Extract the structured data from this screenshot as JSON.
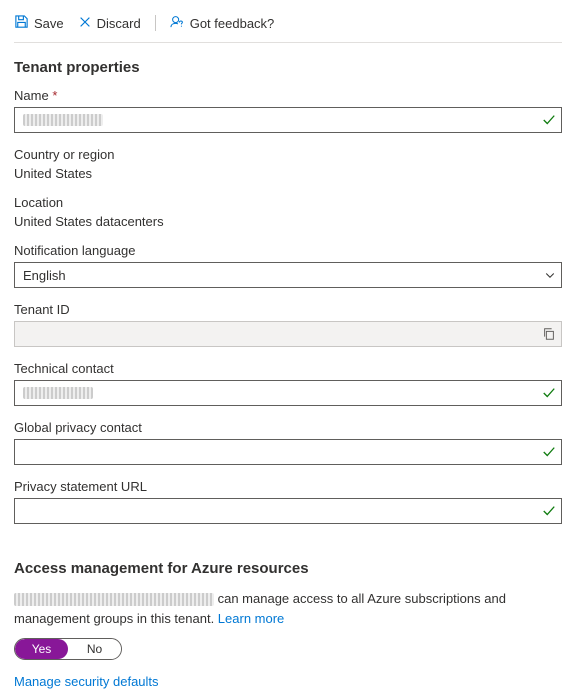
{
  "toolbar": {
    "save": "Save",
    "discard": "Discard",
    "feedback": "Got feedback?"
  },
  "section1": "Tenant properties",
  "fields": {
    "name_label": "Name",
    "name_value": "",
    "country_label": "Country or region",
    "country_value": "United States",
    "location_label": "Location",
    "location_value": "United States datacenters",
    "lang_label": "Notification language",
    "lang_value": "English",
    "tenantid_label": "Tenant ID",
    "tenantid_value": "",
    "techcontact_label": "Technical contact",
    "techcontact_value": "",
    "privacycontact_label": "Global privacy contact",
    "privacycontact_value": "",
    "privacyurl_label": "Privacy statement URL",
    "privacyurl_value": ""
  },
  "section2": "Access management for Azure resources",
  "access": {
    "desc_suffix": " can manage access to all Azure subscriptions and management groups in this tenant. ",
    "learn_more": "Learn more",
    "yes": "Yes",
    "no": "No",
    "selected": "yes"
  },
  "manage_defaults": "Manage security defaults"
}
